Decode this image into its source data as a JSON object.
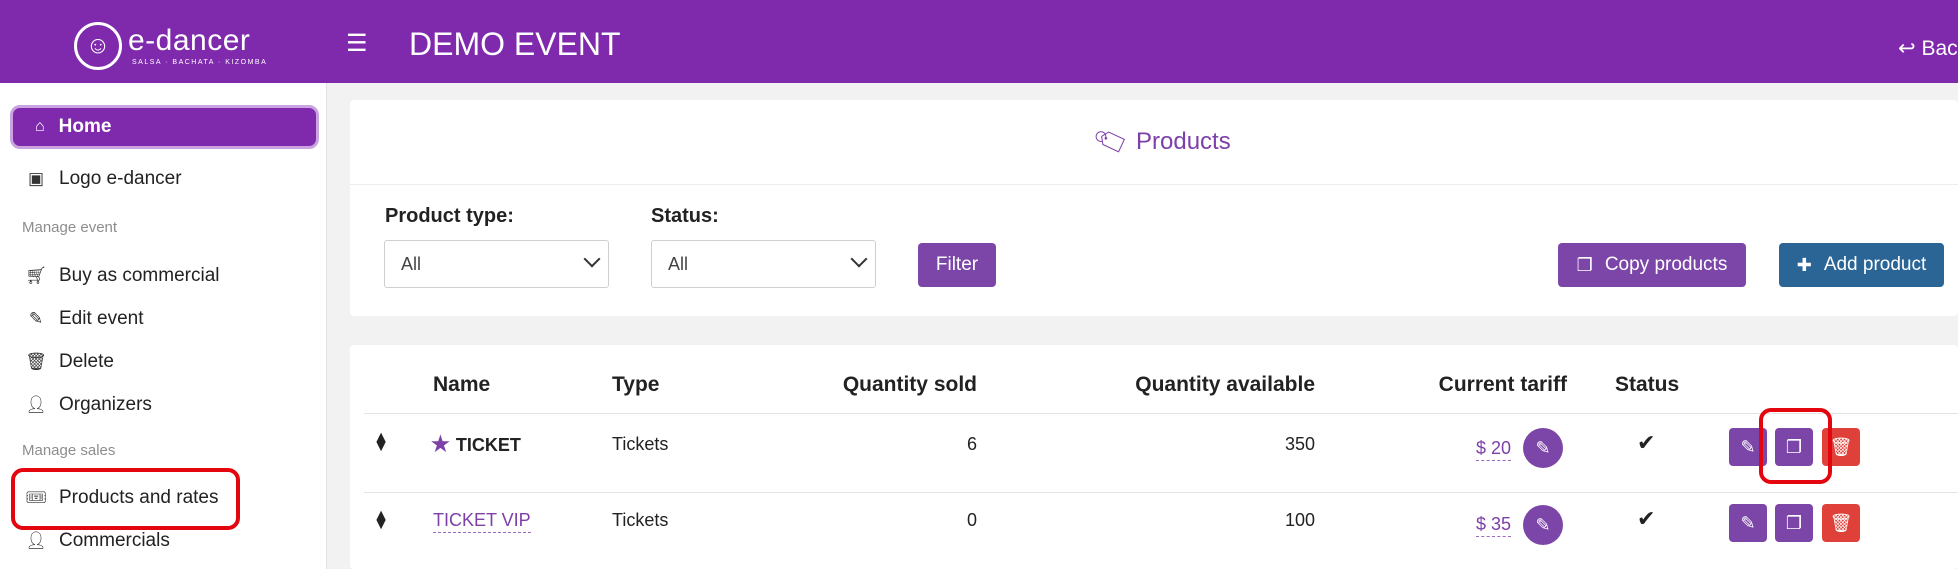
{
  "header": {
    "logo_mark": "☺",
    "logo_name": "e-dancer",
    "logo_tagline": "SALSA · BACHATA · KIZOMBA",
    "menu_icon": "hamburger-icon",
    "event_title": "DEMO EVENT",
    "back_label": "Bac"
  },
  "sidebar": {
    "home": "Home",
    "logo_item": "Logo e-dancer",
    "section_event": "Manage event",
    "buy_commercial": "Buy as commercial",
    "edit_event": "Edit event",
    "delete": "Delete",
    "organizers": "Organizers",
    "section_sales": "Manage sales",
    "products_rates": "Products and rates",
    "commercials": "Commercials"
  },
  "products": {
    "heading": "Products",
    "filters": {
      "product_type_label": "Product type:",
      "product_type_value": "All",
      "status_label": "Status:",
      "status_value": "All",
      "filter_button": "Filter"
    },
    "copy_button": "Copy products",
    "add_button": "Add product",
    "columns": {
      "name": "Name",
      "type": "Type",
      "quantity_sold": "Quantity sold",
      "quantity_available": "Quantity available",
      "current_tariff": "Current tariff",
      "status": "Status"
    },
    "rows": [
      {
        "name": "TICKET",
        "type": "Tickets",
        "quantity_sold": "6",
        "quantity_available": "350",
        "tariff": "$ 20",
        "status": "✔"
      },
      {
        "name": "TICKET VIP",
        "type": "Tickets",
        "quantity_sold": "0",
        "quantity_available": "100",
        "tariff": "$ 35",
        "status": "✔"
      }
    ]
  },
  "colors": {
    "brand_purple": "#7f2aac",
    "button_purple": "#7c46a9",
    "button_blue": "#2a6596",
    "delete_red": "#e0403a",
    "highlight_red": "#e3060f"
  }
}
